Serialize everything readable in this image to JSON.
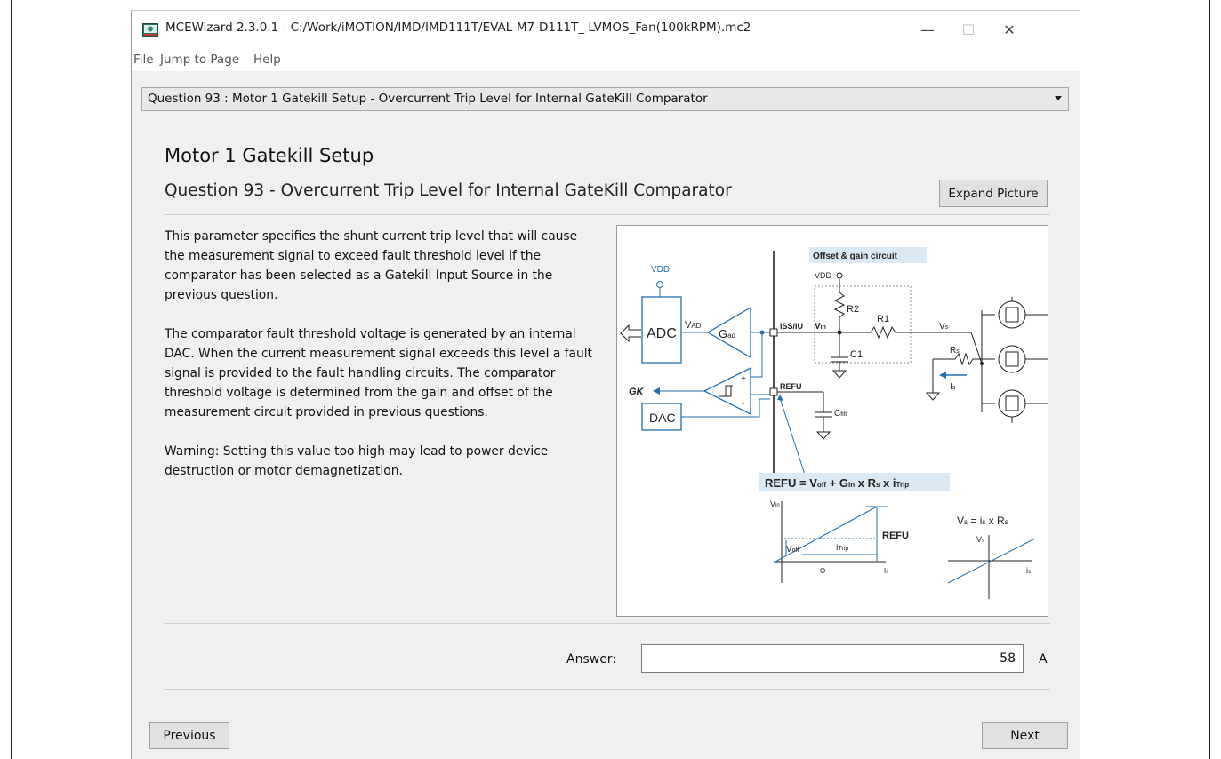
{
  "window": {
    "title": "MCEWizard 2.3.0.1  - C:/Work/iMOTION/IMD/IMD111T/EVAL-M7-D111T_ LVMOS_Fan(100kRPM).mc2",
    "minimize": "—",
    "maximize": "☐",
    "close": "✕"
  },
  "menu": [
    "File",
    "Jump to Page",
    "Help"
  ],
  "question_dropdown": {
    "selected": "Question  93 : Motor 1 Gatekill Setup - Overcurrent Trip Level for Internal GateKill Comparator"
  },
  "page": {
    "section_title": "Motor 1 Gatekill Setup",
    "question_title": "Question 93 - Overcurrent Trip Level for Internal GateKill Comparator",
    "expand_button": "Expand Picture",
    "description": [
      "This parameter specifies the shunt current trip level that will cause the measurement signal to exceed fault threshold level if the comparator has been selected as a Gatekill Input Source in the previous question.",
      "The comparator fault threshold voltage is generated by an internal DAC. When the current measurement signal exceeds this level a fault signal is provided to the fault handling circuits. The comparator threshold voltage is determined from the gain and offset of the measurement circuit provided in previous questions.",
      "Warning: Setting this value too high may lead to power device destruction or motor demagnetization."
    ]
  },
  "diagram": {
    "offset_gain_label": "Offset & gain circuit",
    "vdd": "VDD",
    "adc": "ADC",
    "dac": "DAC",
    "gk": "GK",
    "vad": "V",
    "vad_sub": "AD",
    "gad": "G",
    "gad_sub": "ad",
    "iss_pin": "ISS/IU",
    "vin": "V",
    "vin_sub": "in",
    "r1": "R1",
    "r2": "R2",
    "c1": "C1",
    "vs": "V",
    "vs_sub": "s",
    "rs": "R",
    "rs_sub": "s",
    "is": "I",
    "is_sub": "s",
    "refu": "REFU",
    "cfilt": "C",
    "cfilt_sub": "filt",
    "equation": "REFU = V",
    "eq_voff_sub": "off",
    "eq_mid": " + G",
    "eq_gin_sub": "in",
    "eq_mid2": " x R",
    "eq_rs_sub": "s",
    "eq_mid3": " x i",
    "eq_itrip_sub": "Trip",
    "graph_vin": "V",
    "graph_vin_sub": "in",
    "graph_refu": "REFU",
    "graph_voff": "V",
    "graph_voff_sub": "off",
    "graph_itrip": "I",
    "graph_itrip_sub": "Trip",
    "graph_o": "O",
    "graph_is": "I",
    "graph_is_sub": "s",
    "vs_eq": "V",
    "vs_eq_sub": "s",
    "vs_eq_rest": " = i",
    "vs_eq_is_sub": "s",
    "vs_eq_end": " x R",
    "vs_eq_rs_sub": "s",
    "graph2_vs": "V",
    "graph2_vs_sub": "s",
    "graph2_is": "i",
    "graph2_is_sub": "s",
    "colors": {
      "blue": "#1f6fb2",
      "label_bg": "#dbe9f4"
    }
  },
  "answer": {
    "label": "Answer:",
    "value": "58",
    "unit": "A"
  },
  "nav": {
    "previous": "Previous",
    "next": "Next"
  }
}
